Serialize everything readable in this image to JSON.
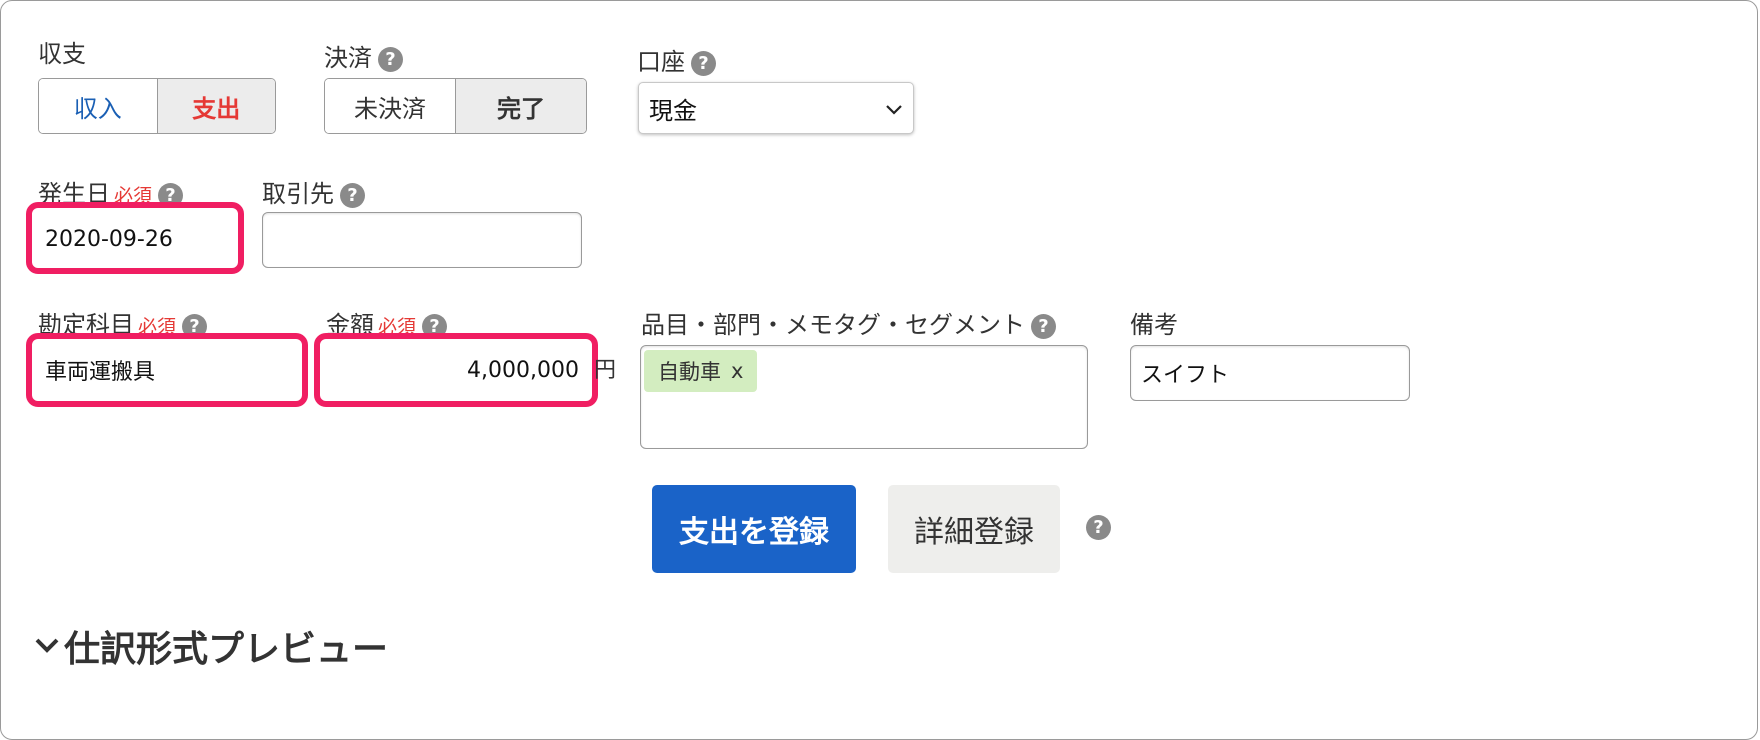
{
  "type_field": {
    "label": "収支",
    "options": [
      "収入",
      "支出"
    ],
    "selected": "支出"
  },
  "settlement_field": {
    "label": "決済",
    "options": [
      "未決済",
      "完了"
    ],
    "selected": "完了"
  },
  "account_field": {
    "label": "口座",
    "value": "現金"
  },
  "date_field": {
    "label": "発生日",
    "required": "必須",
    "value": "2020-09-26"
  },
  "partner_field": {
    "label": "取引先",
    "value": ""
  },
  "account_item_field": {
    "label": "勘定科目",
    "required": "必須",
    "value": "車両運搬具"
  },
  "amount_field": {
    "label": "金額",
    "required": "必須",
    "value": "4,000,000",
    "unit": "円"
  },
  "tags_field": {
    "label": "品目・部門・メモタグ・セグメント",
    "tags": [
      {
        "name": "自動車",
        "remove": "x"
      }
    ]
  },
  "note_field": {
    "label": "備考",
    "value": "スイフト"
  },
  "actions": {
    "submit_label": "支出を登録",
    "detail_label": "詳細登録"
  },
  "preview": {
    "label": "仕訳形式プレビュー"
  },
  "help_glyph": "?",
  "colors": {
    "income": "#1a5fb4",
    "expense": "#e53935",
    "highlight": "#f01e62",
    "primary_button": "#1a63c8",
    "tag_background": "#d3edc0"
  }
}
